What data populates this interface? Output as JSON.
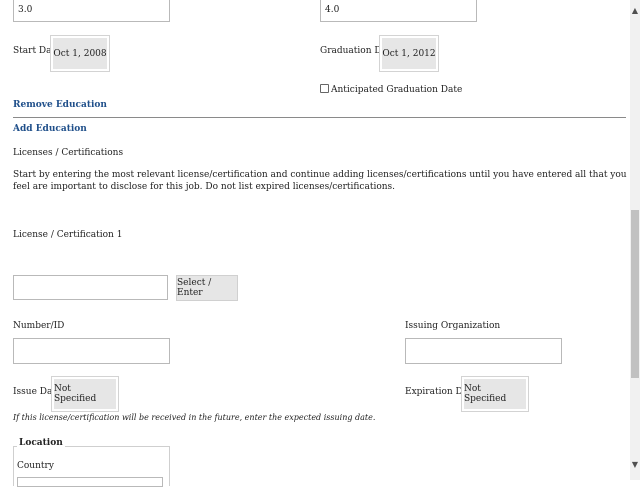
{
  "education": {
    "gpa_value": "3.0",
    "max_gpa_value": "4.0",
    "start_date_label": "Start Date",
    "start_date_value": "Oct 1, 2008",
    "graduation_date_label": "Graduation Date",
    "graduation_date_value": "Oct 1, 2012",
    "anticipated_label": "Anticipated Graduation Date",
    "remove_label": "Remove Education",
    "add_label": "Add Education"
  },
  "licenses": {
    "heading": "Licenses / Certifications",
    "instructions": "Start by entering the most relevant license/certification and continue adding licenses/certifications until you have entered all that you feel are important to disclose for this job. Do not list expired licenses/certifications.",
    "item_title": "License / Certification 1",
    "select_enter_label": "Select / Enter",
    "number_label": "Number/ID",
    "issuing_org_label": "Issuing Organization",
    "issue_date_label": "Issue Date",
    "issue_date_value": "Not Specified",
    "expiration_date_label": "Expiration Date",
    "expiration_date_value": "Not Specified",
    "future_note": "If this license/certification will be received in the future, enter the expected issuing date.",
    "location_legend": "Location",
    "country_label": "Country"
  },
  "icons": {
    "scroll_up": "▲",
    "scroll_down": "▼"
  }
}
